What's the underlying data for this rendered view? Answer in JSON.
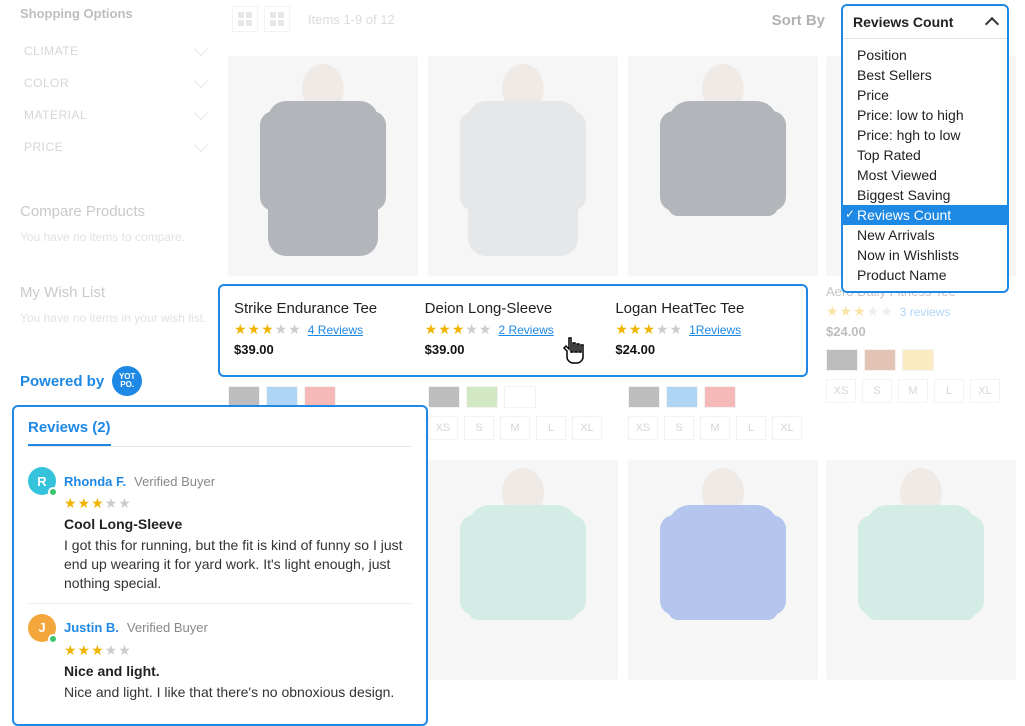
{
  "sidebar": {
    "title": "Shopping Options",
    "filters": [
      "CLIMATE",
      "COLOR",
      "MATERIAL",
      "PRICE"
    ],
    "compare_h": "Compare Products",
    "compare_t": "You have no items to compare.",
    "wish_h": "My Wish List",
    "wish_t": "You have no items in your wish list."
  },
  "toolbar": {
    "items_count": "Items 1-9 of 12",
    "sort_label": "Sort By"
  },
  "sort_dropdown": {
    "selected": "Reviews Count",
    "options": [
      "Position",
      "Best Sellers",
      "Price",
      "Price: low to high",
      "Price: hgh to low",
      "Top Rated",
      "Most Viewed",
      "Biggest Saving",
      "Reviews Count",
      "New Arrivals",
      "Now in Wishlists",
      "Product Name"
    ]
  },
  "sizes": [
    "XS",
    "S",
    "M",
    "L",
    "XL"
  ],
  "row1": {
    "p1": {
      "name": "Strike Endurance Tee",
      "reviews": "4 Reviews",
      "price": "$39.00",
      "stars": 3,
      "swatches": [
        "#444",
        "#1e88e5",
        "#e53935"
      ]
    },
    "p2": {
      "name": "Deion Long-Sleeve",
      "reviews": "2 Reviews",
      "price": "$39.00",
      "stars": 3,
      "swatches": [
        "#444",
        "#7fbf52",
        "#ffffff"
      ]
    },
    "p3": {
      "name": "Logan HeatTec Tee",
      "reviews": "1Reviews",
      "price": "$24.00",
      "stars": 3,
      "swatches": [
        "#444",
        "#1e88e5",
        "#e53935"
      ]
    },
    "p4": {
      "name": "Aero Daily Fitness Tee",
      "reviews": "3 reviews",
      "price": "$24.00",
      "stars": 3.5,
      "swatches": [
        "#444",
        "#b15a2a",
        "#f2c94c"
      ]
    }
  },
  "powered_by": {
    "text": "Powered by",
    "badge": "YOT\nPO."
  },
  "reviews_panel": {
    "tab": "Reviews (2)",
    "reviews": [
      {
        "initial": "R",
        "avatar": "#35c3dc",
        "name": "Rhonda F.",
        "verified": "Verified Buyer",
        "stars": 3,
        "title": "Cool Long-Sleeve",
        "body": "I got this for running, but the fit is kind of funny so I just end up wearing it for yard work. It's light enough, just nothing special."
      },
      {
        "initial": "J",
        "avatar": "#f2a63c",
        "name": "Justin B.",
        "verified": "Verified Buyer",
        "stars": 3,
        "title": "Nice and light.",
        "body": "Nice and light. I like that there's no obnoxious design."
      }
    ]
  }
}
